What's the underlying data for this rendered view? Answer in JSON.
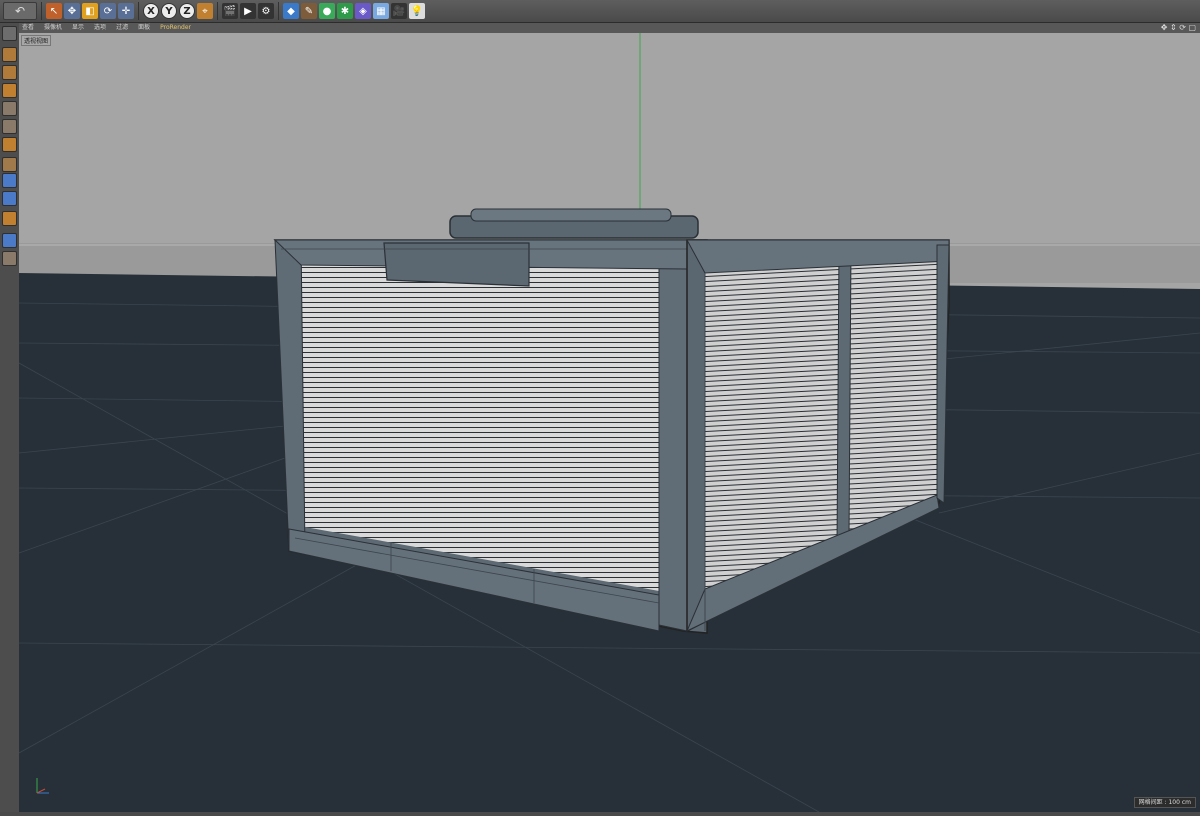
{
  "toolbar": {
    "undo_icon": "undo-icon",
    "buttons": [
      {
        "name": "select-tool",
        "color": "#c0602a"
      },
      {
        "name": "move-tool",
        "color": "#e6a23c"
      },
      {
        "name": "scale-tool",
        "color": "#e6a23c"
      },
      {
        "name": "rotate-tool",
        "color": "#e6a23c"
      },
      {
        "name": "transform-tool",
        "color": "#e6a23c"
      }
    ],
    "axes": [
      "X",
      "Y",
      "Z"
    ]
  },
  "viewport_menu": {
    "items": [
      "查看",
      "摄像机",
      "显示",
      "选项",
      "过滤",
      "面板"
    ],
    "prorender": "ProRender",
    "nav_icons": "✥ ⇕ ⟳ ▢"
  },
  "camera_label": "透视视图",
  "status": {
    "grid_label": "网格间距 : 100 cm"
  },
  "colors": {
    "sky": "#a5a5a5",
    "ground": "#273038",
    "crate": "#5f6b76",
    "planks": "#d6d6d6"
  }
}
